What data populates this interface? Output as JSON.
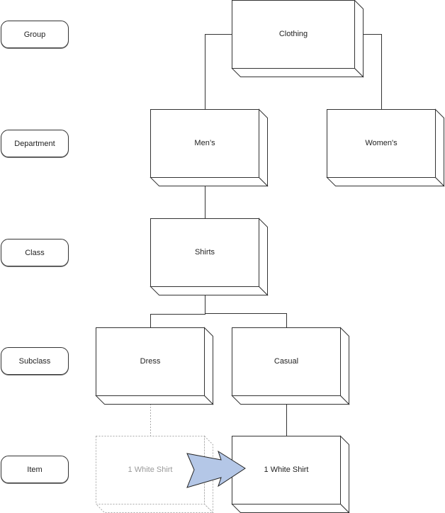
{
  "levels": [
    {
      "label": "Group"
    },
    {
      "label": "Department"
    },
    {
      "label": "Class"
    },
    {
      "label": "Subclass"
    },
    {
      "label": "Item"
    }
  ],
  "nodes": {
    "clothing": {
      "label": "Clothing",
      "level": "Group"
    },
    "mens": {
      "label": "Men’s",
      "level": "Department"
    },
    "womens": {
      "label": "Women's",
      "level": "Department"
    },
    "shirts": {
      "label": "Shirts",
      "level": "Class"
    },
    "dress": {
      "label": "Dress",
      "level": "Subclass"
    },
    "casual": {
      "label": "Casual",
      "level": "Subclass"
    },
    "item_old": {
      "label": "1 White Shirt",
      "level": "Item",
      "style": "ghost"
    },
    "item_new": {
      "label": "1 White Shirt",
      "level": "Item"
    }
  },
  "edges": [
    {
      "from": "clothing",
      "to": "mens"
    },
    {
      "from": "clothing",
      "to": "womens"
    },
    {
      "from": "mens",
      "to": "shirts"
    },
    {
      "from": "shirts",
      "to": "dress"
    },
    {
      "from": "shirts",
      "to": "casual"
    },
    {
      "from": "dress",
      "to": "item_old",
      "style": "dotted"
    },
    {
      "from": "casual",
      "to": "item_new"
    }
  ],
  "move_arrow": {
    "from": "item_old",
    "to": "item_new",
    "fill": "#b4c7e7",
    "stroke": "#222222"
  },
  "colors": {
    "line": "#333333",
    "ghost_line": "#aaaaaa",
    "ghost_text": "#9a9a9a"
  }
}
